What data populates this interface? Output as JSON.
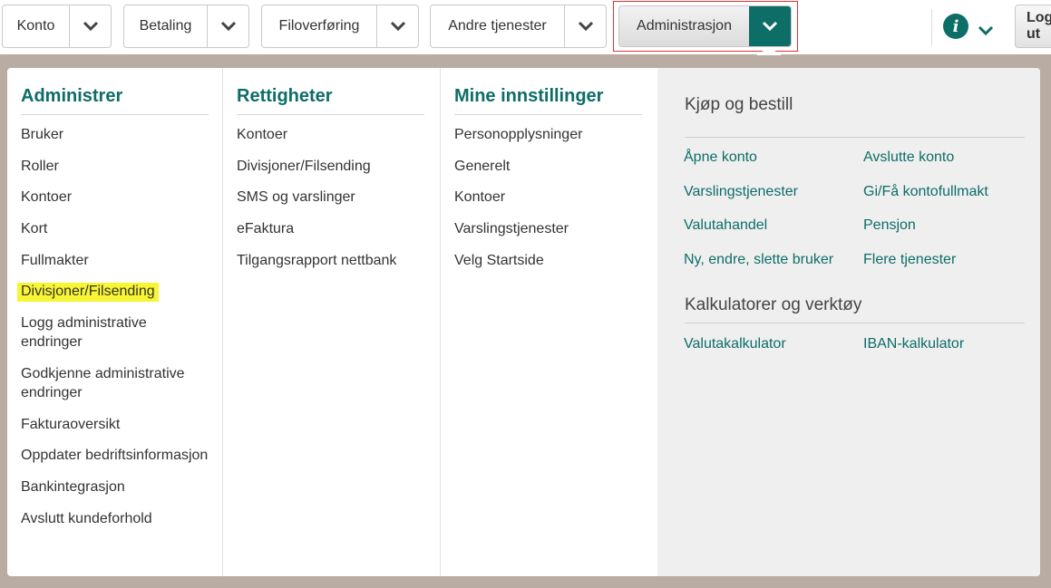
{
  "nav": {
    "items": [
      {
        "label": "Konto"
      },
      {
        "label": "Betaling"
      },
      {
        "label": "Filoverføring"
      },
      {
        "label": "Andre tjenester"
      }
    ],
    "active": {
      "label": "Administrasjon"
    },
    "info_icon_glyph": "i",
    "logout_label": "Logg ut"
  },
  "colors": {
    "accent": "#0d6d67",
    "highlight": "#f8f534"
  },
  "menu": {
    "columns": [
      {
        "heading": "Administrer",
        "items": [
          "Bruker",
          "Roller",
          "Kontoer",
          "Kort",
          "Fullmakter",
          "Divisjoner/Filsending",
          "Logg administrative endringer",
          "Godkjenne administrative endringer",
          "Fakturaoversikt",
          "Oppdater bedriftsinformasjon",
          "Bankintegrasjon",
          "Avslutt kundeforhold"
        ],
        "highlighted": "Divisjoner/Filsending"
      },
      {
        "heading": "Rettigheter",
        "items": [
          "Kontoer",
          "Divisjoner/Filsending",
          "SMS og varslinger",
          "eFaktura",
          "Tilgangsrapport nettbank"
        ]
      },
      {
        "heading": "Mine innstillinger",
        "items": [
          "Personopplysninger",
          "Generelt",
          "Kontoer",
          "Varslingstjenester",
          "Velg Startside"
        ]
      }
    ],
    "buy": {
      "heading": "Kjøp og bestill",
      "links": [
        "Åpne konto",
        "Avslutte konto",
        "Varslingstjenester",
        "Gi/Få kontofullmakt",
        "Valutahandel",
        "Pensjon",
        "Ny, endre, slette bruker",
        "Flere tjenester"
      ]
    },
    "calc": {
      "heading": "Kalkulatorer og verktøy",
      "links": [
        "Valutakalkulator",
        "IBAN-kalkulator"
      ]
    }
  }
}
